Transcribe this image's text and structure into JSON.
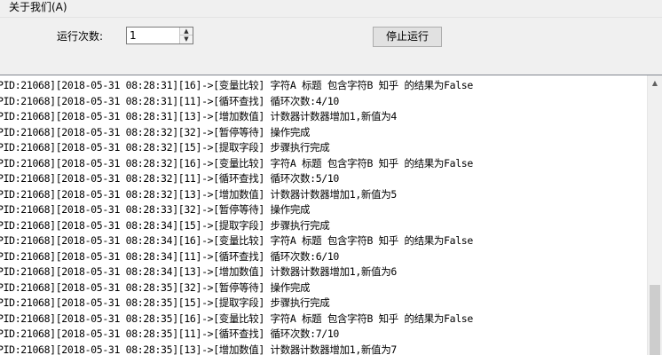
{
  "menu": {
    "about": "关于我们(A)"
  },
  "controls": {
    "run_count_label": "运行次数:",
    "run_count_value": "1",
    "stop_button": "停止运行"
  },
  "icons": {
    "spin_up": "triangle-up-icon",
    "spin_down": "triangle-down-icon",
    "scroll_up": "scroll-up-arrow-icon"
  },
  "log": [
    "PID:21068][2018-05-31 08:28:31][16]->[变量比较] 字符A 标题 包含字符B 知乎 的结果为False",
    "PID:21068][2018-05-31 08:28:31][11]->[循环查找] 循环次数:4/10",
    "PID:21068][2018-05-31 08:28:31][13]->[增加数值] 计数器计数器增加1,新值为4",
    "PID:21068][2018-05-31 08:28:32][32]->[暂停等待] 操作完成",
    "PID:21068][2018-05-31 08:28:32][15]->[提取字段] 步骤执行完成",
    "PID:21068][2018-05-31 08:28:32][16]->[变量比较] 字符A 标题 包含字符B 知乎 的结果为False",
    "PID:21068][2018-05-31 08:28:32][11]->[循环查找] 循环次数:5/10",
    "PID:21068][2018-05-31 08:28:32][13]->[增加数值] 计数器计数器增加1,新值为5",
    "PID:21068][2018-05-31 08:28:33][32]->[暂停等待] 操作完成",
    "PID:21068][2018-05-31 08:28:34][15]->[提取字段] 步骤执行完成",
    "PID:21068][2018-05-31 08:28:34][16]->[变量比较] 字符A 标题 包含字符B 知乎 的结果为False",
    "PID:21068][2018-05-31 08:28:34][11]->[循环查找] 循环次数:6/10",
    "PID:21068][2018-05-31 08:28:34][13]->[增加数值] 计数器计数器增加1,新值为6",
    "PID:21068][2018-05-31 08:28:35][32]->[暂停等待] 操作完成",
    "PID:21068][2018-05-31 08:28:35][15]->[提取字段] 步骤执行完成",
    "PID:21068][2018-05-31 08:28:35][16]->[变量比较] 字符A 标题 包含字符B 知乎 的结果为False",
    "PID:21068][2018-05-31 08:28:35][11]->[循环查找] 循环次数:7/10",
    "PID:21068][2018-05-31 08:28:35][13]->[增加数值] 计数器计数器增加1,新值为7"
  ]
}
